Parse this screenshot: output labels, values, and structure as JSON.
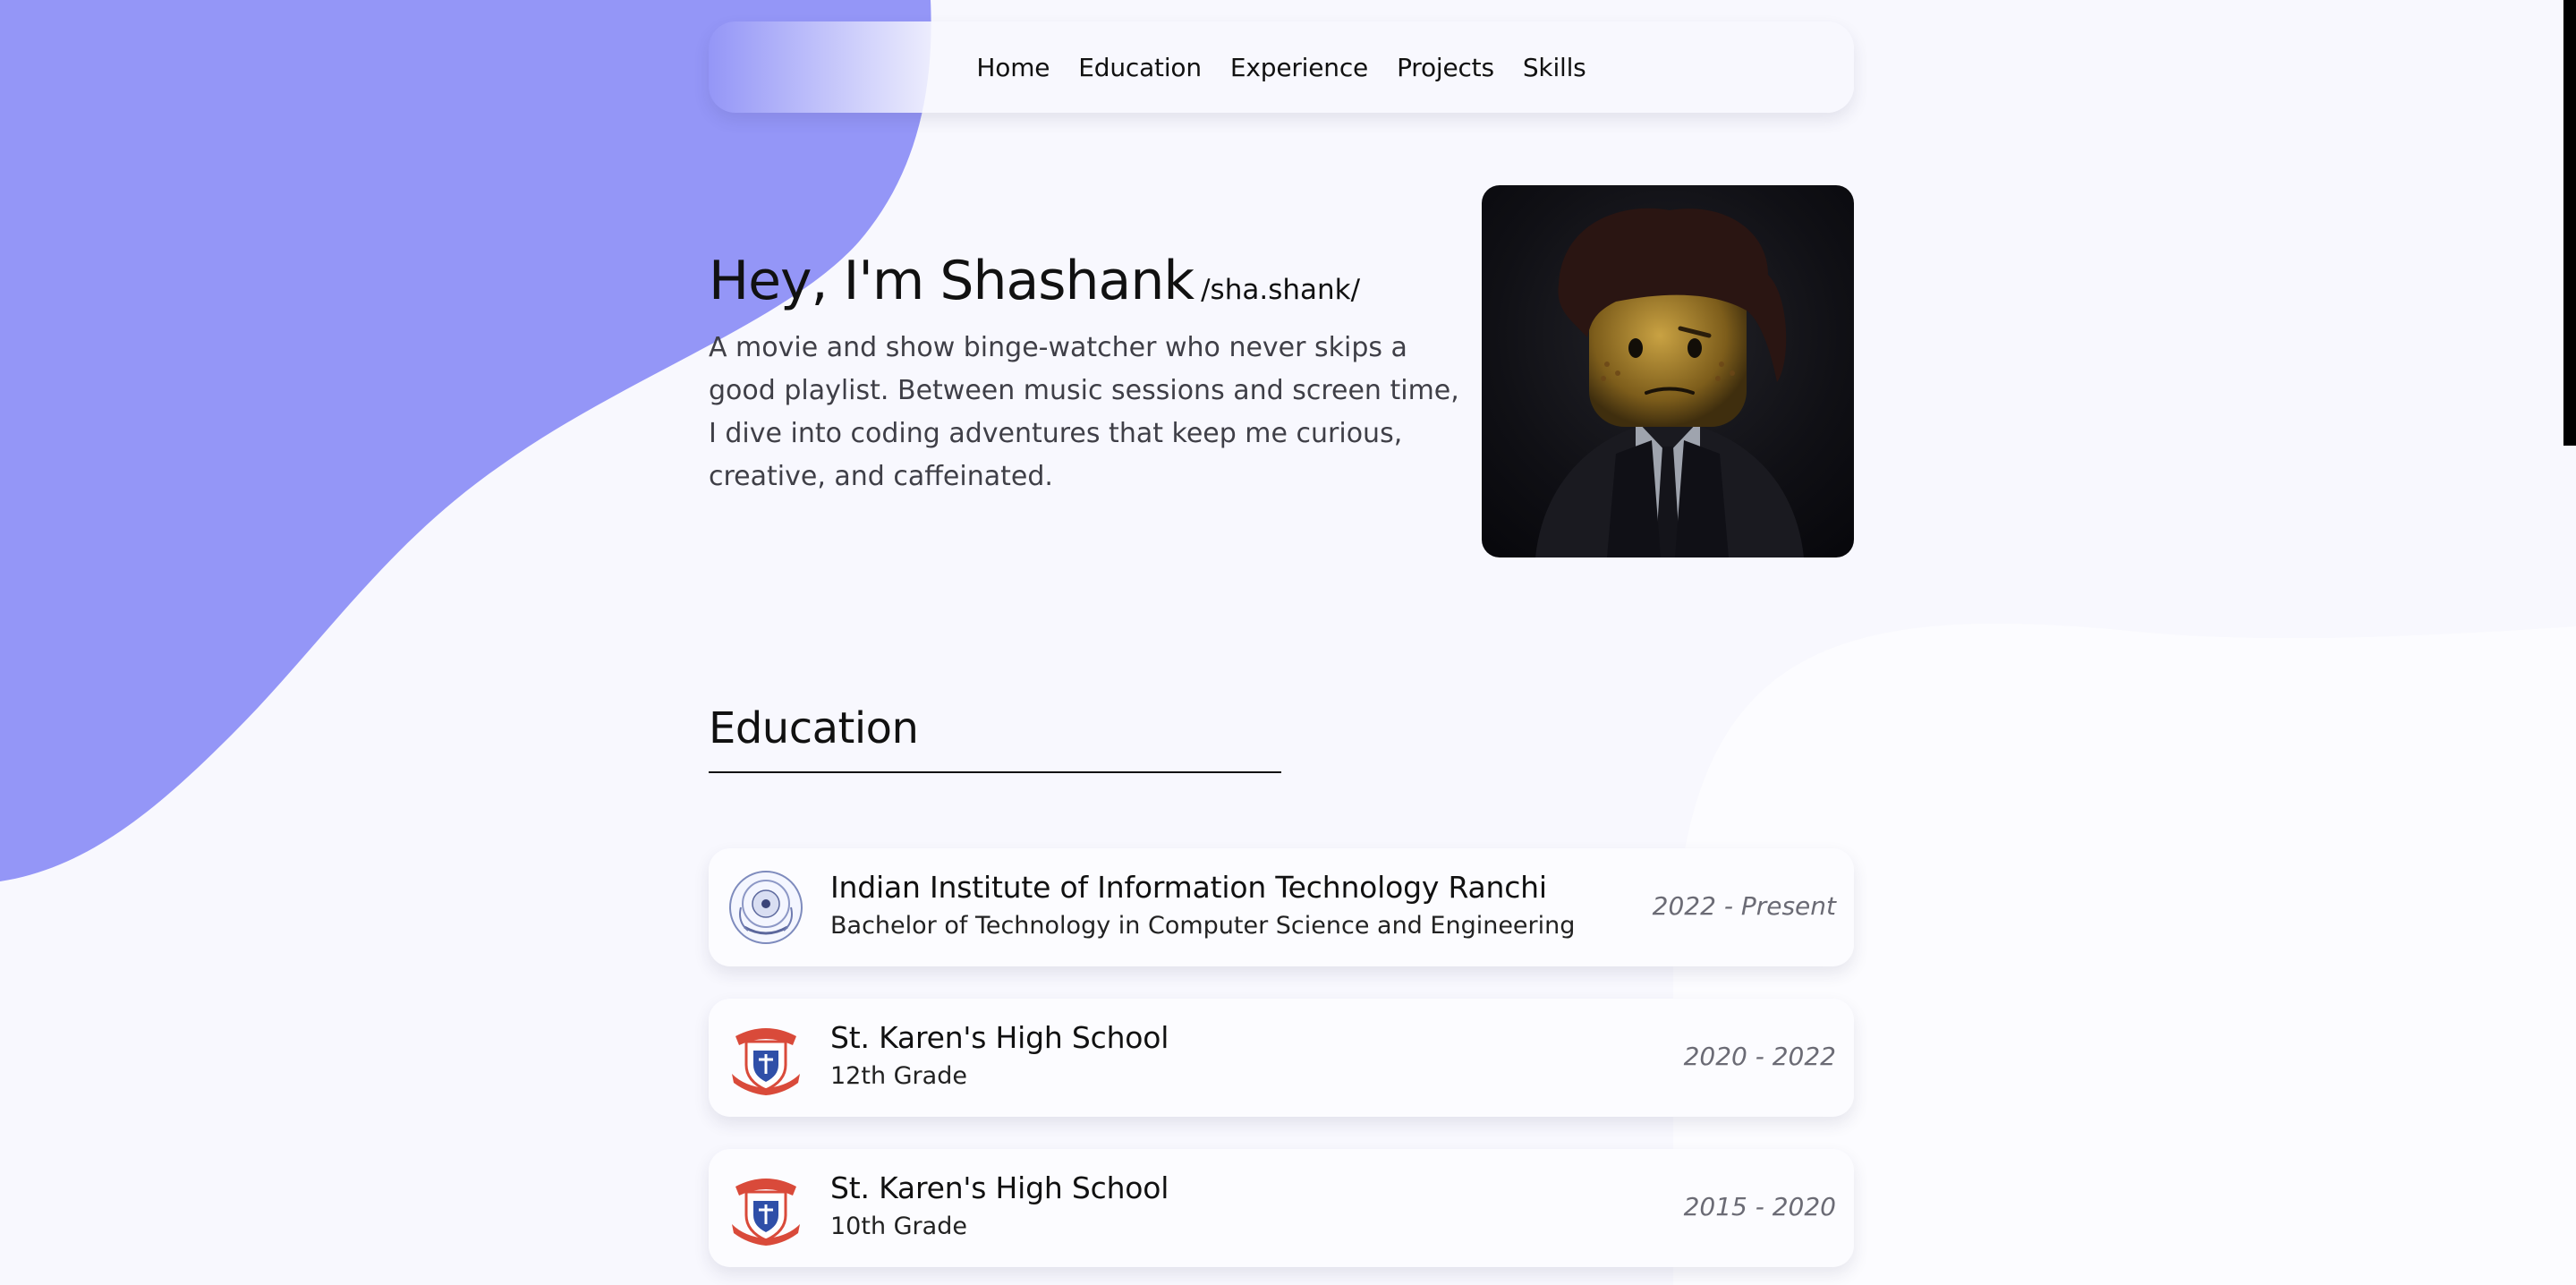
{
  "colors": {
    "blob": "#9496f7",
    "background": "#f8f8fe",
    "text": "#111111",
    "muted": "#6b6b75"
  },
  "nav": {
    "items": [
      {
        "label": "Home"
      },
      {
        "label": "Education"
      },
      {
        "label": "Experience"
      },
      {
        "label": "Projects"
      },
      {
        "label": "Skills"
      }
    ]
  },
  "hero": {
    "greeting": "Hey, I'm Shashank",
    "pronunciation": "/sha.shank/",
    "description": "A movie and show binge-watcher who never skips a good playlist. Between music sessions and screen time, I dive into coding adventures that keep me curious, creative, and caffeinated.",
    "avatar_icon": "lego-minifigure-portrait"
  },
  "education": {
    "title": "Education",
    "items": [
      {
        "school": "Indian Institute of Information Technology Ranchi",
        "degree": "Bachelor of Technology in Computer Science and Engineering",
        "years": "2022 - Present",
        "logo_icon": "iiit-ranchi-seal-icon"
      },
      {
        "school": "St. Karen's High School",
        "degree": "12th Grade",
        "years": "2020 - 2022",
        "logo_icon": "school-crest-icon"
      },
      {
        "school": "St. Karen's High School",
        "degree": "10th Grade",
        "years": "2015 - 2020",
        "logo_icon": "school-crest-icon"
      }
    ]
  }
}
